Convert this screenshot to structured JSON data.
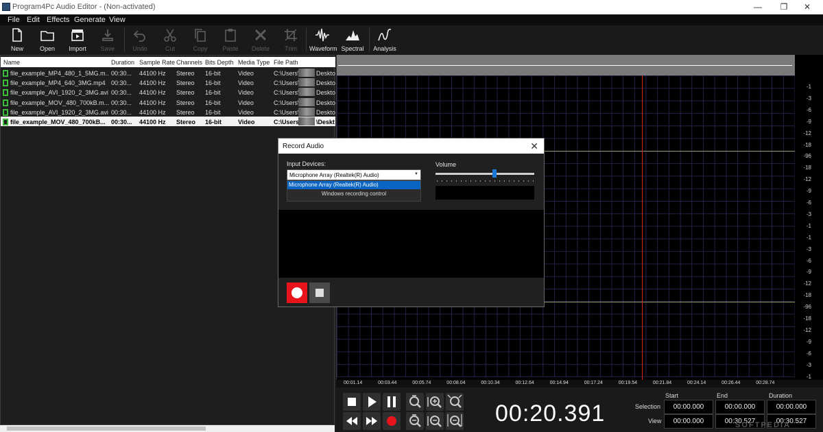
{
  "window": {
    "title": "Program4Pc Audio Editor - (Non-activated)",
    "min": "—",
    "max": "❐",
    "close": "✕"
  },
  "menu": [
    "File",
    "Edit",
    "Effects",
    "Generate",
    "View"
  ],
  "toolbar": {
    "new": "New",
    "open": "Open",
    "import": "Import",
    "save": "Save",
    "undo": "Undo",
    "cut": "Cut",
    "copy": "Copy",
    "paste": "Paste",
    "delete": "Delete",
    "trim": "Trim",
    "waveform": "Waveform",
    "spectral": "Spectral",
    "analysis": "Analysis"
  },
  "files": {
    "columns": [
      "Name",
      "Duration",
      "Sample Rate",
      "Channels",
      "Bits Depth",
      "Media Type",
      "File Path"
    ],
    "rows": [
      {
        "name": "file_example_MP4_480_1_5MG.m...",
        "duration": "00:30...",
        "rate": "44100 Hz",
        "channels": "Stereo",
        "bits": "16-bit",
        "media": "Video",
        "path_a": "C:\\Users\\",
        "path_b": "Deskto"
      },
      {
        "name": "file_example_MP4_640_3MG.mp4",
        "duration": "00:30...",
        "rate": "44100 Hz",
        "channels": "Stereo",
        "bits": "16-bit",
        "media": "Video",
        "path_a": "C:\\Users\\",
        "path_b": "Deskto"
      },
      {
        "name": "file_example_AVI_1920_2_3MG.avi",
        "duration": "00:30...",
        "rate": "44100 Hz",
        "channels": "Stereo",
        "bits": "16-bit",
        "media": "Video",
        "path_a": "C:\\Users\\",
        "path_b": "Deskto"
      },
      {
        "name": "file_example_MOV_480_700kB.m...",
        "duration": "00:30...",
        "rate": "44100 Hz",
        "channels": "Stereo",
        "bits": "16-bit",
        "media": "Video",
        "path_a": "C:\\Users\\",
        "path_b": "Deskto"
      },
      {
        "name": "file_example_AVI_1920_2_3MG.avi",
        "duration": "00:30...",
        "rate": "44100 Hz",
        "channels": "Stereo",
        "bits": "16-bit",
        "media": "Video",
        "path_a": "C:\\Users\\",
        "path_b": "Deskto"
      },
      {
        "name": "file_example_MOV_480_700kB...",
        "duration": "00:30...",
        "rate": "44100 Hz",
        "channels": "Stereo",
        "bits": "16-bit",
        "media": "Video",
        "path_a": "C:\\Users",
        "path_b": "\\Deskt"
      }
    ]
  },
  "db_scale": [
    "-1",
    "-3",
    "-6",
    "-9",
    "-12",
    "-18",
    "-96",
    "-18",
    "-12",
    "-9",
    "-6",
    "-3",
    "-1",
    "-1",
    "-3",
    "-6",
    "-9",
    "-12",
    "-18",
    "-96",
    "-18",
    "-12",
    "-9",
    "-6",
    "-3",
    "-1"
  ],
  "time_ruler": [
    "00:01.14",
    "00:03.44",
    "00:05.74",
    "00:08.04",
    "00:10.34",
    "00:12.64",
    "00:14.94",
    "00:17.24",
    "00:19.54",
    "00:21.84",
    "00:24.14",
    "00:26.44",
    "00:28.74"
  ],
  "transport": {
    "current_time": "00:20.391",
    "start_label": "Start",
    "end_label": "End",
    "duration_label": "Duration",
    "selection_label": "Selection",
    "view_label": "View",
    "sel_start": "00:00.000",
    "sel_end": "00:00.000",
    "sel_duration": "00:00.000",
    "view_start": "00:00.000",
    "view_end": "00:30.527",
    "view_duration": "00:30.527"
  },
  "watermark": "SOFTPEDIA",
  "dialog": {
    "title": "Record Audio",
    "close": "✕",
    "input_label": "Input Devices:",
    "selected_device": "Microphone Array (Realtek(R) Audio)",
    "options": [
      "Microphone Array (Realtek(R) Audio)",
      "Windows recording control"
    ],
    "volume_label": "Volume",
    "volume": 0.6
  },
  "colors": {
    "accent": "#0a64c2",
    "record": "#e8131b",
    "cursor": "#d22222",
    "file_icon": "#3dbb3d"
  }
}
